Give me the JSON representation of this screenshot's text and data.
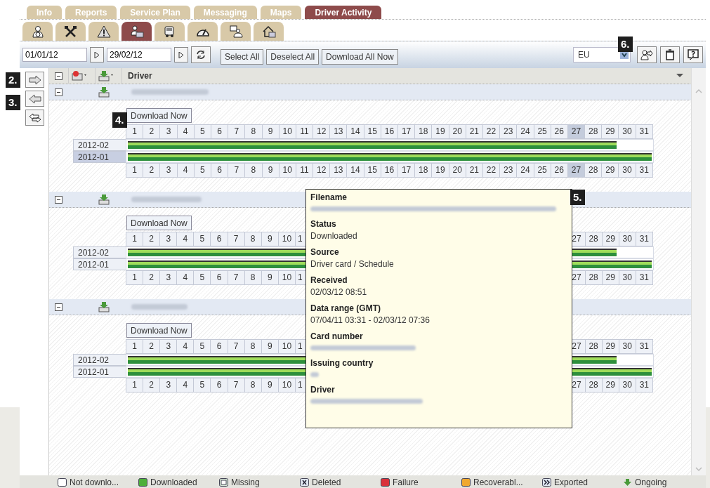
{
  "tabs": [
    {
      "label": "Info",
      "selected": false
    },
    {
      "label": "Reports",
      "selected": false
    },
    {
      "label": "Service Plan",
      "selected": false
    },
    {
      "label": "Messaging",
      "selected": false
    },
    {
      "label": "Maps",
      "selected": false
    },
    {
      "label": "Driver Activity",
      "selected": true
    }
  ],
  "subtabs": [
    {
      "kind": "person",
      "selected": false
    },
    {
      "kind": "tools",
      "selected": false
    },
    {
      "kind": "warning",
      "selected": false
    },
    {
      "kind": "card",
      "selected": true
    },
    {
      "kind": "truck",
      "selected": false
    },
    {
      "kind": "gauge",
      "selected": false
    },
    {
      "kind": "screen",
      "selected": false
    },
    {
      "kind": "house",
      "selected": false
    }
  ],
  "toolbar": {
    "date_from": "01/01/12",
    "date_to": "29/02/12",
    "buttons": [
      "Select All",
      "Deselect All",
      "Download All Now"
    ],
    "region": "EU"
  },
  "callouts": [
    {
      "kind": "export",
      "label": "6."
    },
    {
      "kind": "next",
      "label": "2."
    },
    {
      "kind": "prev",
      "label": "3."
    },
    {
      "kind": "download",
      "label": "4."
    },
    {
      "kind": "day",
      "label": "5."
    }
  ],
  "table": {
    "column": "Driver"
  },
  "groups": [
    {
      "expanded": true,
      "download_label": "Download Now",
      "months": [
        {
          "label": "2012-02",
          "selected": false,
          "level": 0.933
        },
        {
          "label": "2012-01",
          "selected": true,
          "level": 1
        }
      ],
      "day_rows": [
        [
          {
            "kind": "day",
            "label": "1",
            "selected": false
          },
          {
            "kind": "day",
            "label": "2",
            "selected": false
          },
          {
            "kind": "day",
            "label": "3",
            "selected": false
          },
          {
            "kind": "day",
            "label": "4",
            "selected": false
          },
          {
            "kind": "day",
            "label": "5",
            "selected": false
          },
          {
            "kind": "day",
            "label": "6",
            "selected": false
          },
          {
            "kind": "day",
            "label": "7",
            "selected": false
          },
          {
            "kind": "day",
            "label": "8",
            "selected": false
          },
          {
            "kind": "day",
            "label": "9",
            "selected": false
          },
          {
            "kind": "day",
            "label": "10",
            "selected": false
          },
          {
            "kind": "day",
            "label": "11",
            "selected": false
          },
          {
            "kind": "day",
            "label": "12",
            "selected": false
          },
          {
            "kind": "day",
            "label": "13",
            "selected": false
          },
          {
            "kind": "day",
            "label": "14",
            "selected": false
          },
          {
            "kind": "day",
            "label": "15",
            "selected": false
          },
          {
            "kind": "day",
            "label": "16",
            "selected": false
          },
          {
            "kind": "day",
            "label": "17",
            "selected": false
          },
          {
            "kind": "day",
            "label": "18",
            "selected": false
          },
          {
            "kind": "day",
            "label": "19",
            "selected": false
          },
          {
            "kind": "day",
            "label": "20",
            "selected": false
          },
          {
            "kind": "day",
            "label": "21",
            "selected": false
          },
          {
            "kind": "day",
            "label": "22",
            "selected": false
          },
          {
            "kind": "day",
            "label": "23",
            "selected": false
          },
          {
            "kind": "day",
            "label": "24",
            "selected": false
          },
          {
            "kind": "day",
            "label": "25",
            "selected": false
          },
          {
            "kind": "day",
            "label": "26",
            "selected": false
          },
          {
            "kind": "day",
            "label": "27",
            "selected": true
          },
          {
            "kind": "day",
            "label": "28",
            "selected": false
          },
          {
            "kind": "day",
            "label": "29",
            "selected": false
          },
          {
            "kind": "day",
            "label": "30",
            "selected": false
          },
          {
            "kind": "day",
            "label": "31",
            "selected": false
          }
        ],
        [
          {
            "kind": "day",
            "label": "1",
            "selected": false
          },
          {
            "kind": "day",
            "label": "2",
            "selected": false
          },
          {
            "kind": "day",
            "label": "3",
            "selected": false
          },
          {
            "kind": "day",
            "label": "4",
            "selected": false
          },
          {
            "kind": "day",
            "label": "5",
            "selected": false
          },
          {
            "kind": "day",
            "label": "6",
            "selected": false
          },
          {
            "kind": "day",
            "label": "7",
            "selected": false
          },
          {
            "kind": "day",
            "label": "8",
            "selected": false
          },
          {
            "kind": "day",
            "label": "9",
            "selected": false
          },
          {
            "kind": "day",
            "label": "10",
            "selected": false
          },
          {
            "kind": "day",
            "label": "11",
            "selected": false
          },
          {
            "kind": "day",
            "label": "12",
            "selected": false
          },
          {
            "kind": "day",
            "label": "13",
            "selected": false
          },
          {
            "kind": "day",
            "label": "14",
            "selected": false
          },
          {
            "kind": "day",
            "label": "15",
            "selected": false
          },
          {
            "kind": "day",
            "label": "16",
            "selected": false
          },
          {
            "kind": "day",
            "label": "17",
            "selected": false
          },
          {
            "kind": "day",
            "label": "18",
            "selected": false
          },
          {
            "kind": "day",
            "label": "19",
            "selected": false
          },
          {
            "kind": "day",
            "label": "20",
            "selected": false
          },
          {
            "kind": "day",
            "label": "21",
            "selected": false
          },
          {
            "kind": "day",
            "label": "22",
            "selected": false
          },
          {
            "kind": "day",
            "label": "23",
            "selected": false
          },
          {
            "kind": "day",
            "label": "24",
            "selected": false
          },
          {
            "kind": "day",
            "label": "25",
            "selected": false
          },
          {
            "kind": "day",
            "label": "26",
            "selected": false
          },
          {
            "kind": "day",
            "label": "27",
            "selected": true
          },
          {
            "kind": "day",
            "label": "28",
            "selected": false
          },
          {
            "kind": "day",
            "label": "29",
            "selected": false
          },
          {
            "kind": "day",
            "label": "30",
            "selected": false
          },
          {
            "kind": "day",
            "label": "31",
            "selected": false
          }
        ]
      ]
    },
    {
      "expanded": true,
      "download_label": "Download Now",
      "months": [
        {
          "label": "2012-02",
          "selected": false,
          "level": 0.933
        },
        {
          "label": "2012-01",
          "selected": false,
          "level": 1
        }
      ],
      "day_rows": [
        [
          {
            "kind": "day",
            "label": "1",
            "selected": false
          },
          {
            "kind": "day",
            "label": "2",
            "selected": false
          },
          {
            "kind": "day",
            "label": "3",
            "selected": false
          },
          {
            "kind": "day",
            "label": "4",
            "selected": false
          },
          {
            "kind": "day",
            "label": "5",
            "selected": false
          },
          {
            "kind": "day",
            "label": "6",
            "selected": false
          },
          {
            "kind": "day",
            "label": "7",
            "selected": false
          },
          {
            "kind": "day",
            "label": "8",
            "selected": false
          },
          {
            "kind": "day",
            "label": "9",
            "selected": false
          },
          {
            "kind": "day",
            "label": "10",
            "selected": false
          },
          {
            "kind": "cut",
            "label": "1",
            "selected": false
          },
          {
            "kind": "covered"
          },
          {
            "kind": "covered"
          },
          {
            "kind": "covered"
          },
          {
            "kind": "covered"
          },
          {
            "kind": "covered"
          },
          {
            "kind": "covered"
          },
          {
            "kind": "covered"
          },
          {
            "kind": "covered"
          },
          {
            "kind": "covered"
          },
          {
            "kind": "covered"
          },
          {
            "kind": "covered"
          },
          {
            "kind": "covered"
          },
          {
            "kind": "covered"
          },
          {
            "kind": "covered"
          },
          {
            "kind": "covered"
          },
          {
            "kind": "day",
            "label": "27",
            "selected": false
          },
          {
            "kind": "day",
            "label": "28",
            "selected": false
          },
          {
            "kind": "day",
            "label": "29",
            "selected": false
          },
          {
            "kind": "day",
            "label": "30",
            "selected": false
          },
          {
            "kind": "day",
            "label": "31",
            "selected": false
          }
        ],
        [
          {
            "kind": "day",
            "label": "1",
            "selected": false
          },
          {
            "kind": "day",
            "label": "2",
            "selected": false
          },
          {
            "kind": "day",
            "label": "3",
            "selected": false
          },
          {
            "kind": "day",
            "label": "4",
            "selected": false
          },
          {
            "kind": "day",
            "label": "5",
            "selected": false
          },
          {
            "kind": "day",
            "label": "6",
            "selected": false
          },
          {
            "kind": "day",
            "label": "7",
            "selected": false
          },
          {
            "kind": "day",
            "label": "8",
            "selected": false
          },
          {
            "kind": "day",
            "label": "9",
            "selected": false
          },
          {
            "kind": "day",
            "label": "10",
            "selected": false
          },
          {
            "kind": "cut",
            "label": "1",
            "selected": false
          },
          {
            "kind": "covered"
          },
          {
            "kind": "covered"
          },
          {
            "kind": "covered"
          },
          {
            "kind": "covered"
          },
          {
            "kind": "covered"
          },
          {
            "kind": "covered"
          },
          {
            "kind": "covered"
          },
          {
            "kind": "covered"
          },
          {
            "kind": "covered"
          },
          {
            "kind": "covered"
          },
          {
            "kind": "covered"
          },
          {
            "kind": "covered"
          },
          {
            "kind": "covered"
          },
          {
            "kind": "covered"
          },
          {
            "kind": "covered"
          },
          {
            "kind": "day",
            "label": "27",
            "selected": false
          },
          {
            "kind": "day",
            "label": "28",
            "selected": false
          },
          {
            "kind": "day",
            "label": "29",
            "selected": false
          },
          {
            "kind": "day",
            "label": "30",
            "selected": false
          },
          {
            "kind": "day",
            "label": "31",
            "selected": false
          }
        ]
      ]
    },
    {
      "expanded": true,
      "download_label": "Download Now",
      "months": [
        {
          "label": "2012-02",
          "selected": false,
          "level": 0.933
        },
        {
          "label": "2012-01",
          "selected": false,
          "level": 1
        }
      ],
      "day_rows": [
        [
          {
            "kind": "day",
            "label": "1",
            "selected": false
          },
          {
            "kind": "day",
            "label": "2",
            "selected": false
          },
          {
            "kind": "day",
            "label": "3",
            "selected": false
          },
          {
            "kind": "day",
            "label": "4",
            "selected": false
          },
          {
            "kind": "day",
            "label": "5",
            "selected": false
          },
          {
            "kind": "day",
            "label": "6",
            "selected": false
          },
          {
            "kind": "day",
            "label": "7",
            "selected": false
          },
          {
            "kind": "day",
            "label": "8",
            "selected": false
          },
          {
            "kind": "day",
            "label": "9",
            "selected": false
          },
          {
            "kind": "day",
            "label": "10",
            "selected": false
          },
          {
            "kind": "cut",
            "label": "1",
            "selected": false
          },
          {
            "kind": "covered"
          },
          {
            "kind": "covered"
          },
          {
            "kind": "covered"
          },
          {
            "kind": "covered"
          },
          {
            "kind": "covered"
          },
          {
            "kind": "covered"
          },
          {
            "kind": "covered"
          },
          {
            "kind": "covered"
          },
          {
            "kind": "covered"
          },
          {
            "kind": "covered"
          },
          {
            "kind": "covered"
          },
          {
            "kind": "covered"
          },
          {
            "kind": "covered"
          },
          {
            "kind": "covered"
          },
          {
            "kind": "covered"
          },
          {
            "kind": "day",
            "label": "27",
            "selected": false
          },
          {
            "kind": "day",
            "label": "28",
            "selected": false
          },
          {
            "kind": "day",
            "label": "29",
            "selected": false
          },
          {
            "kind": "day",
            "label": "30",
            "selected": false
          },
          {
            "kind": "day",
            "label": "31",
            "selected": false
          }
        ],
        [
          {
            "kind": "day",
            "label": "1",
            "selected": false
          },
          {
            "kind": "day",
            "label": "2",
            "selected": false
          },
          {
            "kind": "day",
            "label": "3",
            "selected": false
          },
          {
            "kind": "day",
            "label": "4",
            "selected": false
          },
          {
            "kind": "day",
            "label": "5",
            "selected": false
          },
          {
            "kind": "day",
            "label": "6",
            "selected": false
          },
          {
            "kind": "day",
            "label": "7",
            "selected": false
          },
          {
            "kind": "day",
            "label": "8",
            "selected": false
          },
          {
            "kind": "day",
            "label": "9",
            "selected": false
          },
          {
            "kind": "day",
            "label": "10",
            "selected": false
          },
          {
            "kind": "cut",
            "label": "1",
            "selected": false
          },
          {
            "kind": "covered"
          },
          {
            "kind": "covered"
          },
          {
            "kind": "covered"
          },
          {
            "kind": "covered"
          },
          {
            "kind": "covered"
          },
          {
            "kind": "covered"
          },
          {
            "kind": "covered"
          },
          {
            "kind": "covered"
          },
          {
            "kind": "covered"
          },
          {
            "kind": "covered"
          },
          {
            "kind": "covered"
          },
          {
            "kind": "covered"
          },
          {
            "kind": "covered"
          },
          {
            "kind": "covered"
          },
          {
            "kind": "covered"
          },
          {
            "kind": "day",
            "label": "27",
            "selected": false
          },
          {
            "kind": "day",
            "label": "28",
            "selected": false
          },
          {
            "kind": "day",
            "label": "29",
            "selected": false
          },
          {
            "kind": "day",
            "label": "30",
            "selected": false
          },
          {
            "kind": "day",
            "label": "31",
            "selected": false
          }
        ]
      ]
    }
  ],
  "tooltip": {
    "fields": [
      {
        "label": "Filename",
        "kind": "blurred"
      },
      {
        "label": "Status",
        "kind": "text",
        "value": "Downloaded"
      },
      {
        "label": "Source",
        "kind": "text",
        "value": "Driver card / Schedule"
      },
      {
        "label": "Received",
        "kind": "text",
        "value": "02/03/12 08:51"
      },
      {
        "label": "Data range (GMT)",
        "kind": "text",
        "value": "07/04/11 03:31 - 02/03/12 07:36"
      },
      {
        "label": "Card number",
        "kind": "blurred"
      },
      {
        "label": "Issuing country",
        "kind": "blurred"
      },
      {
        "label": "Driver",
        "kind": "blurred"
      }
    ]
  },
  "legend": [
    {
      "kind": "box",
      "color": "#ffffff",
      "label": "Not downlo..."
    },
    {
      "kind": "box",
      "color": "#4caf3a",
      "label": "Downloaded"
    },
    {
      "kind": "inner",
      "color": "#d8e8d8",
      "label": "Missing"
    },
    {
      "kind": "cross",
      "color": "#dfe6f0",
      "label": "Deleted"
    },
    {
      "kind": "box",
      "color": "#d9303a",
      "label": "Failure"
    },
    {
      "kind": "box",
      "color": "#f0a830",
      "label": "Recoverabl..."
    },
    {
      "kind": "chevrons",
      "color": "#dfe6f0",
      "label": "Exported"
    },
    {
      "kind": "arrow",
      "color": "#4a9a3a",
      "label": "Ongoing"
    }
  ]
}
